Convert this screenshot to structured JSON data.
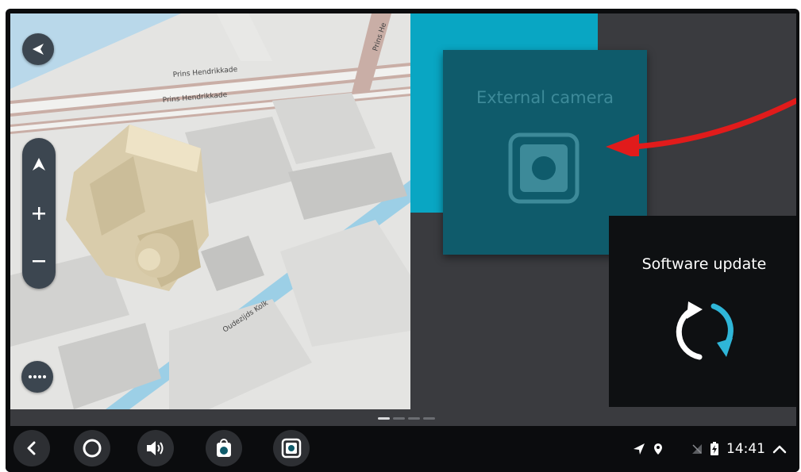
{
  "map": {
    "street_labels": [
      "Prins Hendrikkade",
      "Prins Hendrikkade",
      "Oudezijds Kolk",
      "Prins He"
    ]
  },
  "tiles": {
    "external_camera": {
      "label": "External camera",
      "icon": "camera-icon"
    },
    "software_update": {
      "label": "Software update",
      "icon": "refresh-icon"
    }
  },
  "pager": {
    "pages": 4,
    "active_index": 0
  },
  "bottom_bar": {
    "buttons": [
      "back-icon",
      "home-icon",
      "volume-icon",
      "app-icon",
      "camera-app-icon"
    ],
    "status_icons": [
      "navigation-arrow-icon",
      "location-icon",
      "wifi-icon",
      "signal-icon",
      "battery-icon"
    ],
    "clock": "14:41",
    "expand_icon": "chevron-up-icon"
  },
  "colors": {
    "accent_cyan": "#09a6c3",
    "camera_tile": "#0f5b6b",
    "annotation_red": "#e11b1b",
    "update_blue": "#2fb6d8"
  }
}
